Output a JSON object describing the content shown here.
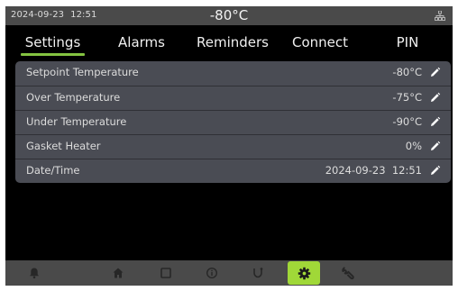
{
  "status": {
    "date": "2024-09-23",
    "time": "12:51",
    "temperature": "-80°C",
    "network_icon": "network-icon"
  },
  "tabs": [
    {
      "label": "Settings",
      "active": true
    },
    {
      "label": "Alarms",
      "active": false
    },
    {
      "label": "Reminders",
      "active": false
    },
    {
      "label": "Connect",
      "active": false
    },
    {
      "label": "PIN",
      "active": false
    }
  ],
  "settings": [
    {
      "label": "Setpoint Temperature",
      "value": "-80°C"
    },
    {
      "label": "Over Temperature",
      "value": "-75°C"
    },
    {
      "label": "Under Temperature",
      "value": "-90°C"
    },
    {
      "label": "Gasket Heater",
      "value": "0%"
    },
    {
      "label": "Date/Time",
      "value": "2024-09-23  12:51"
    }
  ],
  "nav": [
    {
      "icon": "bell-icon",
      "active": false
    },
    {
      "icon": "home-icon",
      "active": false
    },
    {
      "icon": "chart-icon",
      "active": false
    },
    {
      "icon": "info-icon",
      "active": false
    },
    {
      "icon": "probe-icon",
      "active": false
    },
    {
      "icon": "gear-icon",
      "active": true
    },
    {
      "icon": "wrench-icon",
      "active": false
    }
  ],
  "colors": {
    "accent": "#84c341",
    "active_nav": "#a0d838",
    "panel": "#4a4c54",
    "bar": "#4a4a4a"
  }
}
